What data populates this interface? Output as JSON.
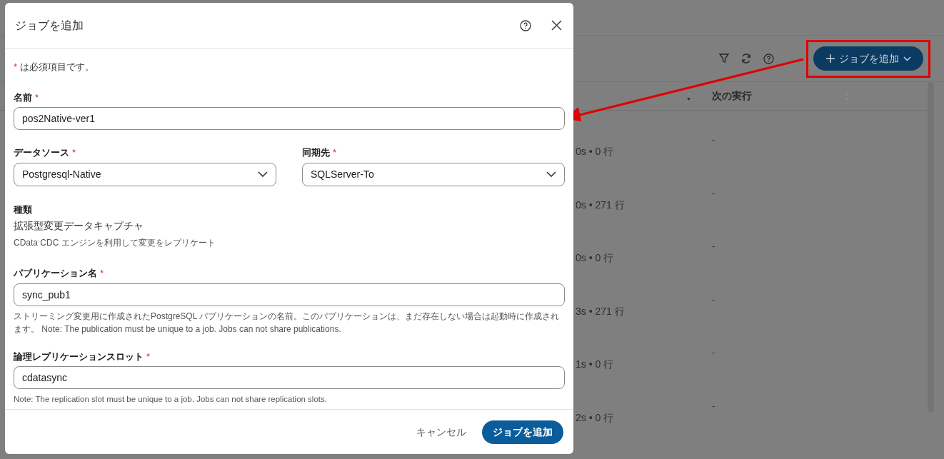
{
  "background": {
    "toolbar": {
      "add_button": "ジョブを追加"
    },
    "table": {
      "columns": [
        "次の実行"
      ],
      "rows": [
        {
          "column_1": "0s • 0 行",
          "next_run": "-"
        },
        {
          "column_1": "0s • 271 行",
          "next_run": "-"
        },
        {
          "column_1": "0s • 0 行",
          "next_run": "-"
        },
        {
          "column_1": "3s • 271 行",
          "next_run": "-"
        },
        {
          "column_1": "1s • 0 行",
          "next_run": "-"
        },
        {
          "column_1": "2s • 0 行",
          "next_run": "-"
        }
      ]
    }
  },
  "dialog": {
    "title": "ジョブを追加",
    "required_note": {
      "mark": "*",
      "text": "は必須項目です。"
    },
    "name": {
      "label": "名前",
      "required_mark": "*",
      "value": "pos2Native-ver1"
    },
    "data_source": {
      "label": "データソース",
      "required_mark": "*",
      "value": "Postgresql-Native"
    },
    "destination": {
      "label": "同期先",
      "required_mark": "*",
      "value": "SQLServer-To"
    },
    "type": {
      "label": "種類",
      "value": "拡張型変更データキャプチャ",
      "description": "CData CDC エンジンを利用して変更をレプリケート"
    },
    "publication": {
      "label": "パブリケーション名",
      "required_mark": "*",
      "value": "sync_pub1",
      "help": "ストリーミング変更用に作成されたPostgreSQL パブリケーションの名前。このパブリケーションは、まだ存在しない場合は起動時に作成されます。 Note: The publication must be unique to a job. Jobs can not share publications."
    },
    "slot": {
      "label": "論理レプリケーションスロット",
      "required_mark": "*",
      "value": "cdatasync",
      "help": "Note: The replication slot must be unique to a job. Jobs can not share replication slots."
    },
    "buttons": {
      "cancel": "キャンセル",
      "submit": "ジョブを追加"
    }
  }
}
